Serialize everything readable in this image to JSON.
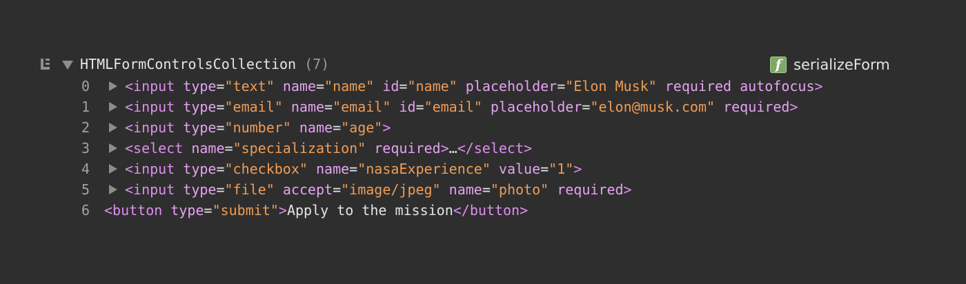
{
  "collection": {
    "name": "HTMLFormControlsCollection",
    "count": "(7)"
  },
  "source": {
    "badge": "f",
    "function_name": "serializeForm"
  },
  "rows": [
    {
      "index": "0",
      "parts": [
        {
          "t": "tag",
          "s": "<input"
        },
        {
          "t": "sp",
          "s": " "
        },
        {
          "t": "attr",
          "s": "type"
        },
        {
          "t": "eq",
          "s": "="
        },
        {
          "t": "val",
          "s": "\"text\""
        },
        {
          "t": "sp",
          "s": " "
        },
        {
          "t": "attr",
          "s": "name"
        },
        {
          "t": "eq",
          "s": "="
        },
        {
          "t": "val",
          "s": "\"name\""
        },
        {
          "t": "sp",
          "s": " "
        },
        {
          "t": "attr",
          "s": "id"
        },
        {
          "t": "eq",
          "s": "="
        },
        {
          "t": "val",
          "s": "\"name\""
        },
        {
          "t": "sp",
          "s": " "
        },
        {
          "t": "attr",
          "s": "placeholder"
        },
        {
          "t": "eq",
          "s": "="
        },
        {
          "t": "val",
          "s": "\"Elon Musk\""
        },
        {
          "t": "sp",
          "s": " "
        },
        {
          "t": "attr",
          "s": "required"
        },
        {
          "t": "sp",
          "s": " "
        },
        {
          "t": "attr",
          "s": "autofocus"
        },
        {
          "t": "tag",
          "s": ">"
        }
      ]
    },
    {
      "index": "1",
      "parts": [
        {
          "t": "tag",
          "s": "<input"
        },
        {
          "t": "sp",
          "s": " "
        },
        {
          "t": "attr",
          "s": "type"
        },
        {
          "t": "eq",
          "s": "="
        },
        {
          "t": "val",
          "s": "\"email\""
        },
        {
          "t": "sp",
          "s": " "
        },
        {
          "t": "attr",
          "s": "name"
        },
        {
          "t": "eq",
          "s": "="
        },
        {
          "t": "val",
          "s": "\"email\""
        },
        {
          "t": "sp",
          "s": " "
        },
        {
          "t": "attr",
          "s": "id"
        },
        {
          "t": "eq",
          "s": "="
        },
        {
          "t": "val",
          "s": "\"email\""
        },
        {
          "t": "sp",
          "s": " "
        },
        {
          "t": "attr",
          "s": "placeholder"
        },
        {
          "t": "eq",
          "s": "="
        },
        {
          "t": "val",
          "s": "\"elon@musk.com\""
        },
        {
          "t": "sp",
          "s": " "
        },
        {
          "t": "attr",
          "s": "required"
        },
        {
          "t": "tag",
          "s": ">"
        }
      ]
    },
    {
      "index": "2",
      "parts": [
        {
          "t": "tag",
          "s": "<input"
        },
        {
          "t": "sp",
          "s": " "
        },
        {
          "t": "attr",
          "s": "type"
        },
        {
          "t": "eq",
          "s": "="
        },
        {
          "t": "val",
          "s": "\"number\""
        },
        {
          "t": "sp",
          "s": " "
        },
        {
          "t": "attr",
          "s": "name"
        },
        {
          "t": "eq",
          "s": "="
        },
        {
          "t": "val",
          "s": "\"age\""
        },
        {
          "t": "tag",
          "s": ">"
        }
      ]
    },
    {
      "index": "3",
      "parts": [
        {
          "t": "tag",
          "s": "<select"
        },
        {
          "t": "sp",
          "s": " "
        },
        {
          "t": "attr",
          "s": "name"
        },
        {
          "t": "eq",
          "s": "="
        },
        {
          "t": "val",
          "s": "\"specialization\""
        },
        {
          "t": "sp",
          "s": " "
        },
        {
          "t": "attr",
          "s": "required"
        },
        {
          "t": "tag",
          "s": ">"
        },
        {
          "t": "txt",
          "s": "…"
        },
        {
          "t": "tag",
          "s": "</select>"
        }
      ]
    },
    {
      "index": "4",
      "parts": [
        {
          "t": "tag",
          "s": "<input"
        },
        {
          "t": "sp",
          "s": " "
        },
        {
          "t": "attr",
          "s": "type"
        },
        {
          "t": "eq",
          "s": "="
        },
        {
          "t": "val",
          "s": "\"checkbox\""
        },
        {
          "t": "sp",
          "s": " "
        },
        {
          "t": "attr",
          "s": "name"
        },
        {
          "t": "eq",
          "s": "="
        },
        {
          "t": "val",
          "s": "\"nasaExperience\""
        },
        {
          "t": "sp",
          "s": " "
        },
        {
          "t": "attr",
          "s": "value"
        },
        {
          "t": "eq",
          "s": "="
        },
        {
          "t": "val",
          "s": "\"1\""
        },
        {
          "t": "tag",
          "s": ">"
        }
      ]
    },
    {
      "index": "5",
      "parts": [
        {
          "t": "tag",
          "s": "<input"
        },
        {
          "t": "sp",
          "s": " "
        },
        {
          "t": "attr",
          "s": "type"
        },
        {
          "t": "eq",
          "s": "="
        },
        {
          "t": "val",
          "s": "\"file\""
        },
        {
          "t": "sp",
          "s": " "
        },
        {
          "t": "attr",
          "s": "accept"
        },
        {
          "t": "eq",
          "s": "="
        },
        {
          "t": "val",
          "s": "\"image/jpeg\""
        },
        {
          "t": "sp",
          "s": " "
        },
        {
          "t": "attr",
          "s": "name"
        },
        {
          "t": "eq",
          "s": "="
        },
        {
          "t": "val",
          "s": "\"photo\""
        },
        {
          "t": "sp",
          "s": " "
        },
        {
          "t": "attr",
          "s": "required"
        },
        {
          "t": "tag",
          "s": ">"
        }
      ]
    },
    {
      "index": "6",
      "parts": [
        {
          "t": "tag",
          "s": "<button"
        },
        {
          "t": "sp",
          "s": " "
        },
        {
          "t": "attr",
          "s": "type"
        },
        {
          "t": "eq",
          "s": "="
        },
        {
          "t": "val",
          "s": "\"submit\""
        },
        {
          "t": "tag",
          "s": ">"
        },
        {
          "t": "txt",
          "s": "Apply to the mission"
        },
        {
          "t": "tag",
          "s": "</button>"
        }
      ]
    }
  ]
}
